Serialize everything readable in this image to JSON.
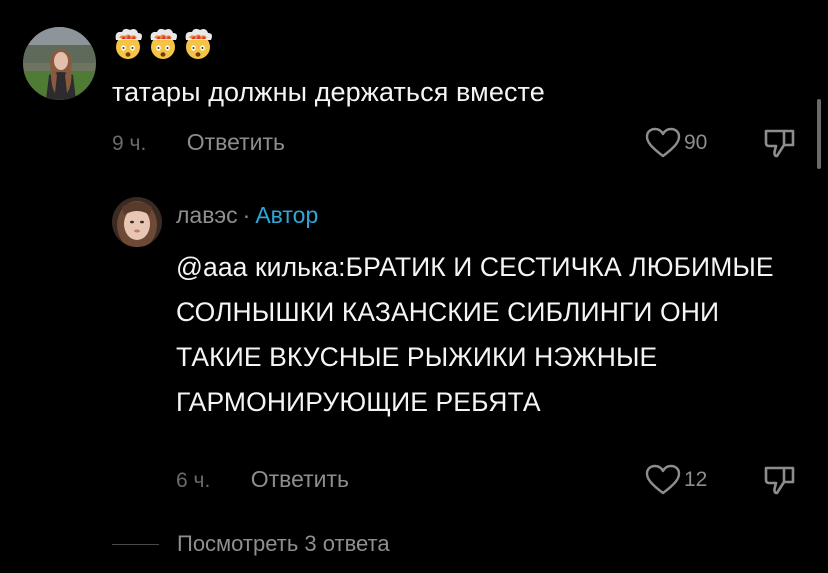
{
  "comments": [
    {
      "emojis": [
        "exploding-head-emoji",
        "exploding-head-emoji",
        "exploding-head-emoji"
      ],
      "text": "татары должны держаться вместе",
      "time": "9 ч.",
      "reply_label": "Ответить",
      "likes": "90"
    },
    {
      "author": "лавэс",
      "separator": "·",
      "author_badge": "Автор",
      "text": "@ааа килька:БРАТИК И СЕСТИЧКА ЛЮБИМЫЕ СОЛНЫШКИ КАЗАНСКИЕ СИБЛИНГИ ОНИ ТАКИЕ ВКУСНЫЕ РЫЖИКИ НЭЖНЫЕ ГАРМОНИРУЮЩИЕ РЕБЯТА",
      "time": "6 ч.",
      "reply_label": "Ответить",
      "likes": "12"
    }
  ],
  "view_replies_label": "Посмотреть 3 ответа",
  "colors": {
    "background": "#000000",
    "text": "#f5f5f5",
    "muted": "#8d8d8d",
    "author_badge": "#2fa6d8"
  },
  "icons": {
    "like": "heart-outline-icon",
    "dislike": "thumbs-down-outline-icon"
  }
}
